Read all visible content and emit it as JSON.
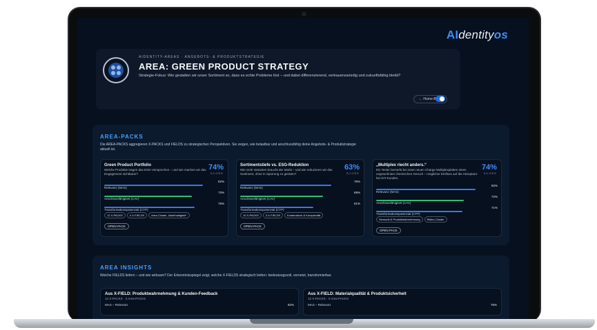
{
  "brand": {
    "prefix": "AI",
    "middle": "dentity",
    "suffix": "os"
  },
  "hero": {
    "eyebrow": "AIDENTITY-AREAS · ANGEBOTS- & PRODUKTSTRATEGIE",
    "title": "AREA: GREEN PRODUCT STRATEGY",
    "description": "Strategie-Fokus: Wie gestalten wir unser Sortiment so, dass es echte Probleme löst – und dabei differenzierend, vertrauenswürdig und zukunftsfähig bleibt?",
    "home_button": "← Home-Base",
    "theme_toggle_on": true
  },
  "area_packs": {
    "title": "AREA-PACKS",
    "description": "Die AREA-PACKS aggregieren X-PACKS und FIELDS zu strategischen Perspektiven. Sie zeigen, wie belastbar und anschlussfähig deine Angebots- & Produktstrategie aktuell ist.",
    "score_label": "SCORE",
    "open_label": "OPEN PACK",
    "cards": [
      {
        "title": "Green Product Portfolio",
        "subtitle": "Welche Produkte tragen das ESG-Versprechen – und wie machen wir das Engagement sichtbarer?",
        "score": "74%",
        "metrics": [
          {
            "label": "Relevanz (MAS)",
            "value": "82%",
            "fill": 0.82,
            "color": "#2f7cf0"
          },
          {
            "label": "Anschlussfähigkeit (CAV)",
            "value": "73%",
            "fill": 0.73,
            "color": "#2fc06f"
          },
          {
            "label": "Transformationspotenzial (CTP)",
            "value": "75%",
            "fill": 0.75,
            "color": "#2f7cf0"
          }
        ],
        "tags": [
          "12 X-PACKS",
          "4 X-FIELDS",
          "Area-Cluster „Nachhaltigkeit“"
        ]
      },
      {
        "title": "Sortimentstiefe vs. ESG-Reduktion",
        "subtitle": "Wie viele Varianten braucht der Markt – und wie reduzieren wir das Sortiment, ohne in Sparrung zu geraten?",
        "score": "63%",
        "metrics": [
          {
            "label": "Relevanz (MAS)",
            "value": "76%",
            "fill": 0.76,
            "color": "#2f7cf0"
          },
          {
            "label": "Anschlussfähigkeit (CAV)",
            "value": "69%",
            "fill": 0.69,
            "color": "#2fc06f"
          },
          {
            "label": "Transformationspotenzial (CTP)",
            "value": "61%",
            "fill": 0.61,
            "color": "#2f7cf0"
          }
        ],
        "tags": [
          "10 X-PACKS",
          "3 X-FIELDS",
          "Kostendruck & Komplexität"
        ]
      },
      {
        "title": "„Multiplex riecht anders.“",
        "subtitle": "Ein Tester bemerkt bei einer neuen Charge Multiplexplatten einen ungewohnten chemischen Geruch – möglicher Einfluss auf die Akzeptanz bei DIY-Kunden.",
        "score": "74%",
        "metrics": [
          {
            "label": "Relevanz (MAS)",
            "value": "82%",
            "fill": 0.82,
            "color": "#2f7cf0"
          },
          {
            "label": "Anschlussfähigkeit (CAV)",
            "value": "72%",
            "fill": 0.72,
            "color": "#2fc06f"
          },
          {
            "label": "Transformationspotenzial (CTP)",
            "value": "71%",
            "fill": 0.71,
            "color": "#2f7cf0"
          }
        ],
        "tags": [
          "Sensorik & Produktwahrnehmung",
          "Risiko-Cluster"
        ]
      }
    ]
  },
  "area_insights": {
    "title": "AREA INSIGHTS",
    "description": "Welche FIELDS liefern – und wie wirksam? Der Erkenntnisspiegel zeigt, welche X-FIELDS strategisch liefern: bedeutungsvoll, vernetzt, transformierbar.",
    "cards": [
      {
        "title": "Aus X-FIELD: Produktwahrnehmung & Kunden-Feedback",
        "subtitle": "12 X-PACKS · 3 Area-PACKS",
        "metric_label": "MAS – Relevanz",
        "metric_value": "82%"
      },
      {
        "title": "Aus X-FIELD: Materialqualität & Produktsicherheit",
        "subtitle": "12 X-PACKS · 3 Area-PACKS",
        "metric_label": "MAS – Relevanz",
        "metric_value": "76%"
      }
    ]
  }
}
